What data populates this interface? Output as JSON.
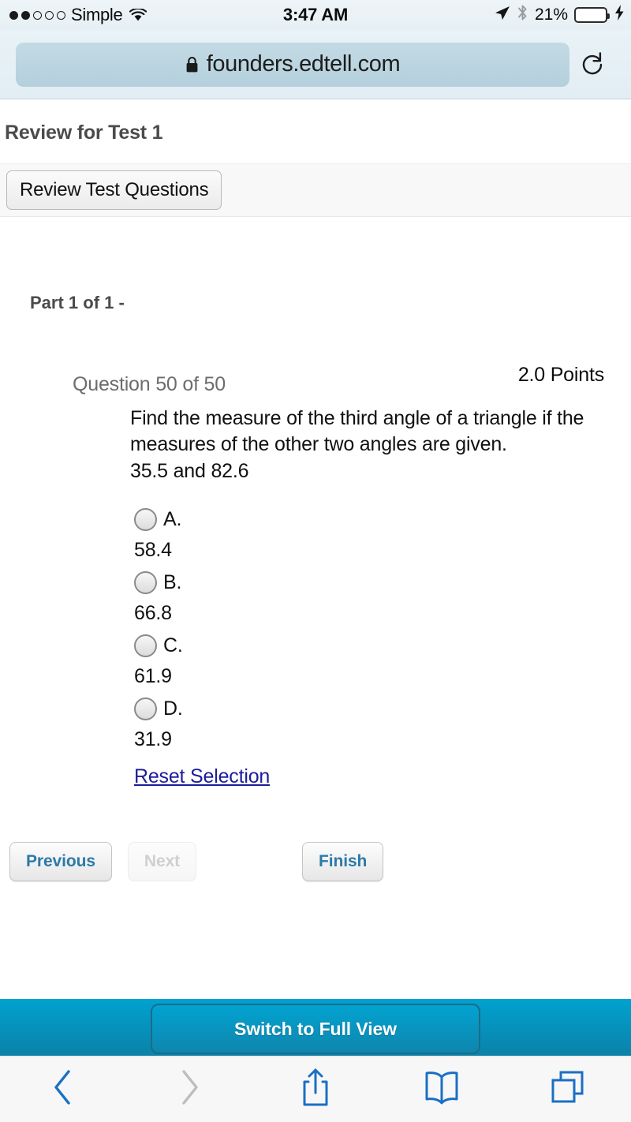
{
  "status_bar": {
    "carrier": "Simple",
    "signal_dots_filled": 2,
    "signal_dots_total": 5,
    "wifi_icon": "wifi-icon",
    "time": "3:47 AM",
    "location_icon": "location-arrow-icon",
    "bluetooth_icon": "bluetooth-icon",
    "battery_percent": "21%",
    "battery_fill_ratio": 0.21,
    "battery_color": "#ffcc00",
    "charging_icon": "lightning-bolt-icon"
  },
  "browser": {
    "lock_icon": "lock-icon",
    "url": "founders.edtell.com",
    "reload_icon": "reload-icon",
    "url_bar_bg": "#b8d4df"
  },
  "page": {
    "title": "Review for Test 1",
    "review_button_label": "Review Test Questions",
    "part_label": "Part 1 of 1 -"
  },
  "question": {
    "number_label": "Question 50 of 50",
    "points_label": "2.0 Points",
    "prompt_line1": "Find the measure of the third angle of a triangle if the",
    "prompt_line2": "measures of the other two angles are given.",
    "prompt_line3": "35.5 and 82.6",
    "options": [
      {
        "letter": "A.",
        "value": "58.4"
      },
      {
        "letter": "B.",
        "value": "66.8"
      },
      {
        "letter": "C.",
        "value": "61.9"
      },
      {
        "letter": "D.",
        "value": "31.9"
      }
    ],
    "reset_link_label": "Reset Selection",
    "reset_link_color": "#1c1c9c"
  },
  "nav_buttons": {
    "previous_label": "Previous",
    "next_label": "Next",
    "finish_label": "Finish",
    "enabled_text_color": "#2b7aa8",
    "disabled_text_color": "#cfcfcf"
  },
  "full_view": {
    "button_label": "Switch to Full View",
    "band_color_top": "#00a2d0",
    "band_color_bottom": "#0c80a6"
  },
  "safari_toolbar": {
    "back_icon": "chevron-left-icon",
    "forward_icon": "chevron-right-icon",
    "share_icon": "share-icon",
    "bookmarks_icon": "book-icon",
    "tabs_icon": "tabs-icon",
    "active_color": "#1a6fc4",
    "disabled_color": "#bdbdbd"
  }
}
